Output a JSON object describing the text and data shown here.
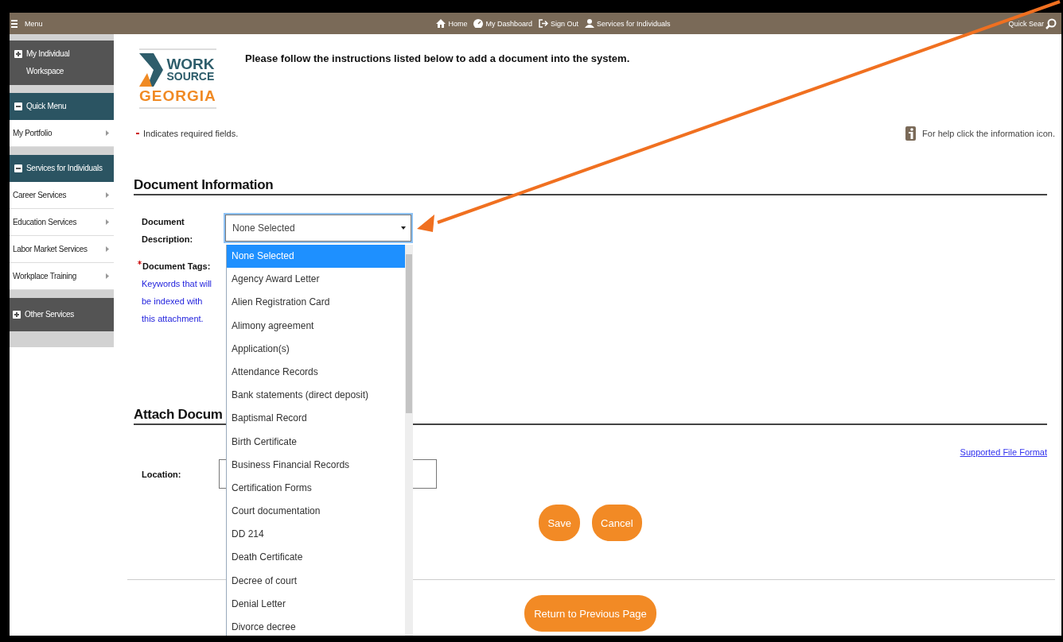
{
  "top_bar": {
    "menu_label": "Menu",
    "nav": [
      {
        "kind": "home",
        "label": "Home"
      },
      {
        "kind": "dashboard",
        "label": "My Dashboard"
      },
      {
        "kind": "signout",
        "label": "Sign Out"
      },
      {
        "kind": "person",
        "label": "Services for Individuals"
      }
    ],
    "quick_search": "Quick Sear"
  },
  "sidebar": {
    "sections": [
      {
        "title": "My Individual Workspace",
        "expanded": false
      },
      {
        "title": "Quick Menu",
        "expanded": true,
        "items": [
          {
            "label": "My Portfolio"
          }
        ]
      },
      {
        "title": "Services for Individuals",
        "expanded": true,
        "items": [
          {
            "label": "Career Services"
          },
          {
            "label": "Education Services"
          },
          {
            "label": "Labor Market Services"
          },
          {
            "label": "Workplace Training"
          }
        ]
      },
      {
        "title": "Other Services",
        "expanded": false
      }
    ]
  },
  "logo": {
    "line1": "WORK",
    "line2": "SOURCE",
    "line3": "GEORGIA"
  },
  "instructions": "Please follow the instructions listed below to add a document into the system.",
  "required_note": "Indicates required fields.",
  "help_text": "For help click the information icon.",
  "document_information": {
    "heading": "Document Information",
    "description_label": "Document Description:",
    "select": {
      "value": "None Selected",
      "expanded": true,
      "options": [
        {
          "label": "None Selected",
          "selected": true
        },
        {
          "label": "Agency Award Letter",
          "selected": false
        },
        {
          "label": "Alien Registration Card",
          "selected": false
        },
        {
          "label": "Alimony agreement",
          "selected": false
        },
        {
          "label": "Application(s)",
          "selected": false
        },
        {
          "label": "Attendance Records",
          "selected": false
        },
        {
          "label": "Bank statements (direct deposit)",
          "selected": false
        },
        {
          "label": "Baptismal Record",
          "selected": false
        },
        {
          "label": "Birth Certificate",
          "selected": false
        },
        {
          "label": "Business Financial Records",
          "selected": false
        },
        {
          "label": "Certification Forms",
          "selected": false
        },
        {
          "label": "Court documentation",
          "selected": false
        },
        {
          "label": "DD 214",
          "selected": false
        },
        {
          "label": "Death Certificate",
          "selected": false
        },
        {
          "label": "Decree of court",
          "selected": false
        },
        {
          "label": "Denial Letter",
          "selected": false
        },
        {
          "label": "Divorce decree",
          "selected": false
        }
      ]
    },
    "tags_label": "Document Tags:",
    "tags_required": true,
    "tags_hint": "Keywords that will be indexed with this attachment."
  },
  "attach_document": {
    "heading": "Attach Docum",
    "location_label": "Location:",
    "supported_link": "Supported File Format",
    "buttons": [
      "Save",
      "Cancel"
    ]
  },
  "return_button": "Return to Previous Page"
}
